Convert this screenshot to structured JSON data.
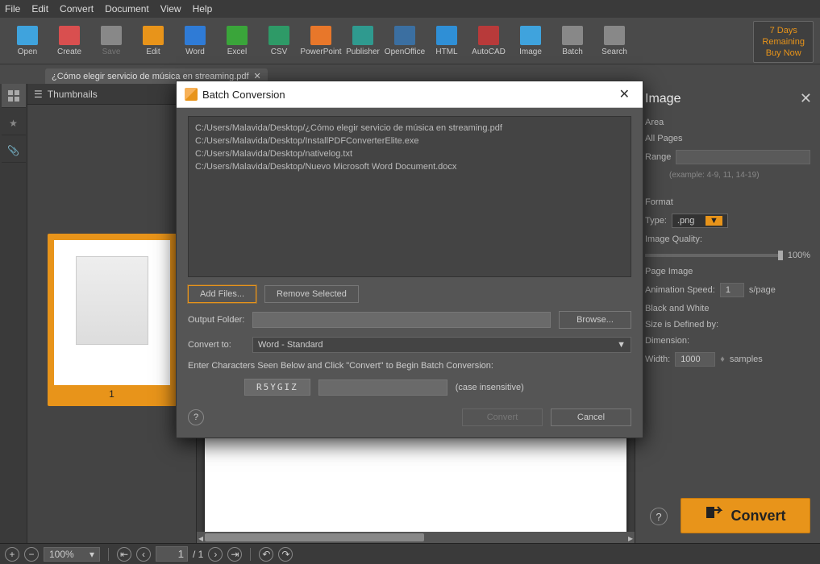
{
  "menu": {
    "items": [
      "File",
      "Edit",
      "Convert",
      "Document",
      "View",
      "Help"
    ]
  },
  "toolbar": {
    "buttons": [
      {
        "name": "open",
        "label": "Open",
        "color": "#3fa3dd"
      },
      {
        "name": "create",
        "label": "Create",
        "color": "#d94f4f"
      },
      {
        "name": "save",
        "label": "Save",
        "color": "#888",
        "disabled": true
      },
      {
        "name": "edit",
        "label": "Edit",
        "color": "#e8941a"
      },
      {
        "name": "word",
        "label": "Word",
        "color": "#2f7bd6"
      },
      {
        "name": "excel",
        "label": "Excel",
        "color": "#3aa53a"
      },
      {
        "name": "csv",
        "label": "CSV",
        "color": "#2e9a67"
      },
      {
        "name": "powerpoint",
        "label": "PowerPoint",
        "color": "#e8772a"
      },
      {
        "name": "publisher",
        "label": "Publisher",
        "color": "#2f9a8f"
      },
      {
        "name": "openoffice",
        "label": "OpenOffice",
        "color": "#3b6fa1"
      },
      {
        "name": "html",
        "label": "HTML",
        "color": "#2f8fd6"
      },
      {
        "name": "autocad",
        "label": "AutoCAD",
        "color": "#b83a3a"
      },
      {
        "name": "image",
        "label": "Image",
        "color": "#3fa3dd"
      },
      {
        "name": "batch",
        "label": "Batch",
        "color": "#888"
      },
      {
        "name": "search",
        "label": "Search",
        "color": "#888"
      }
    ]
  },
  "trial": {
    "line1": "7 Days",
    "line2": "Remaining",
    "line3": "Buy Now"
  },
  "doc_tab": "¿Cómo elegir servicio de música en streaming.pdf",
  "thumbnails": {
    "title": "Thumbnails",
    "page_num": "1"
  },
  "right_panel": {
    "title": "Image",
    "area_label": "Area",
    "all_pages": "All Pages",
    "range_label": "Range",
    "example": "(example: 4-9, 11, 14-19)",
    "format_label": "Format",
    "type_label": "Type:",
    "type_value": ".png",
    "quality_label": "Image Quality:",
    "quality_value": "100%",
    "page_image_label": "Page Image",
    "anim_label": "Animation Speed:",
    "anim_value": "1",
    "anim_unit": "s/page",
    "bw_label": "Black and White",
    "defined_label": "Size is Defined by:",
    "dimension_label": "Dimension:",
    "width_label": "Width:",
    "width_value": "1000",
    "samples_label": "samples",
    "convert_btn": "Convert"
  },
  "statusbar": {
    "zoom": "100%",
    "page": "1",
    "total": "/ 1"
  },
  "dialog": {
    "title": "Batch Conversion",
    "files": [
      "C:/Users/Malavida/Desktop/¿Cómo elegir servicio de música en streaming.pdf",
      "C:/Users/Malavida/Desktop/InstallPDFConverterElite.exe",
      "C:/Users/Malavida/Desktop/nativelog.txt",
      "C:/Users/Malavida/Desktop/Nuevo Microsoft Word Document.docx"
    ],
    "add_files": "Add Files...",
    "remove_selected": "Remove Selected",
    "output_folder": "Output Folder:",
    "browse": "Browse...",
    "convert_to": "Convert to:",
    "convert_to_value": "Word - Standard",
    "captcha_instruction": "Enter Characters Seen Below and Click \"Convert\" to Begin Batch Conversion:",
    "captcha": "R5YGIZ",
    "case_note": "(case insensitive)",
    "convert": "Convert",
    "cancel": "Cancel"
  }
}
